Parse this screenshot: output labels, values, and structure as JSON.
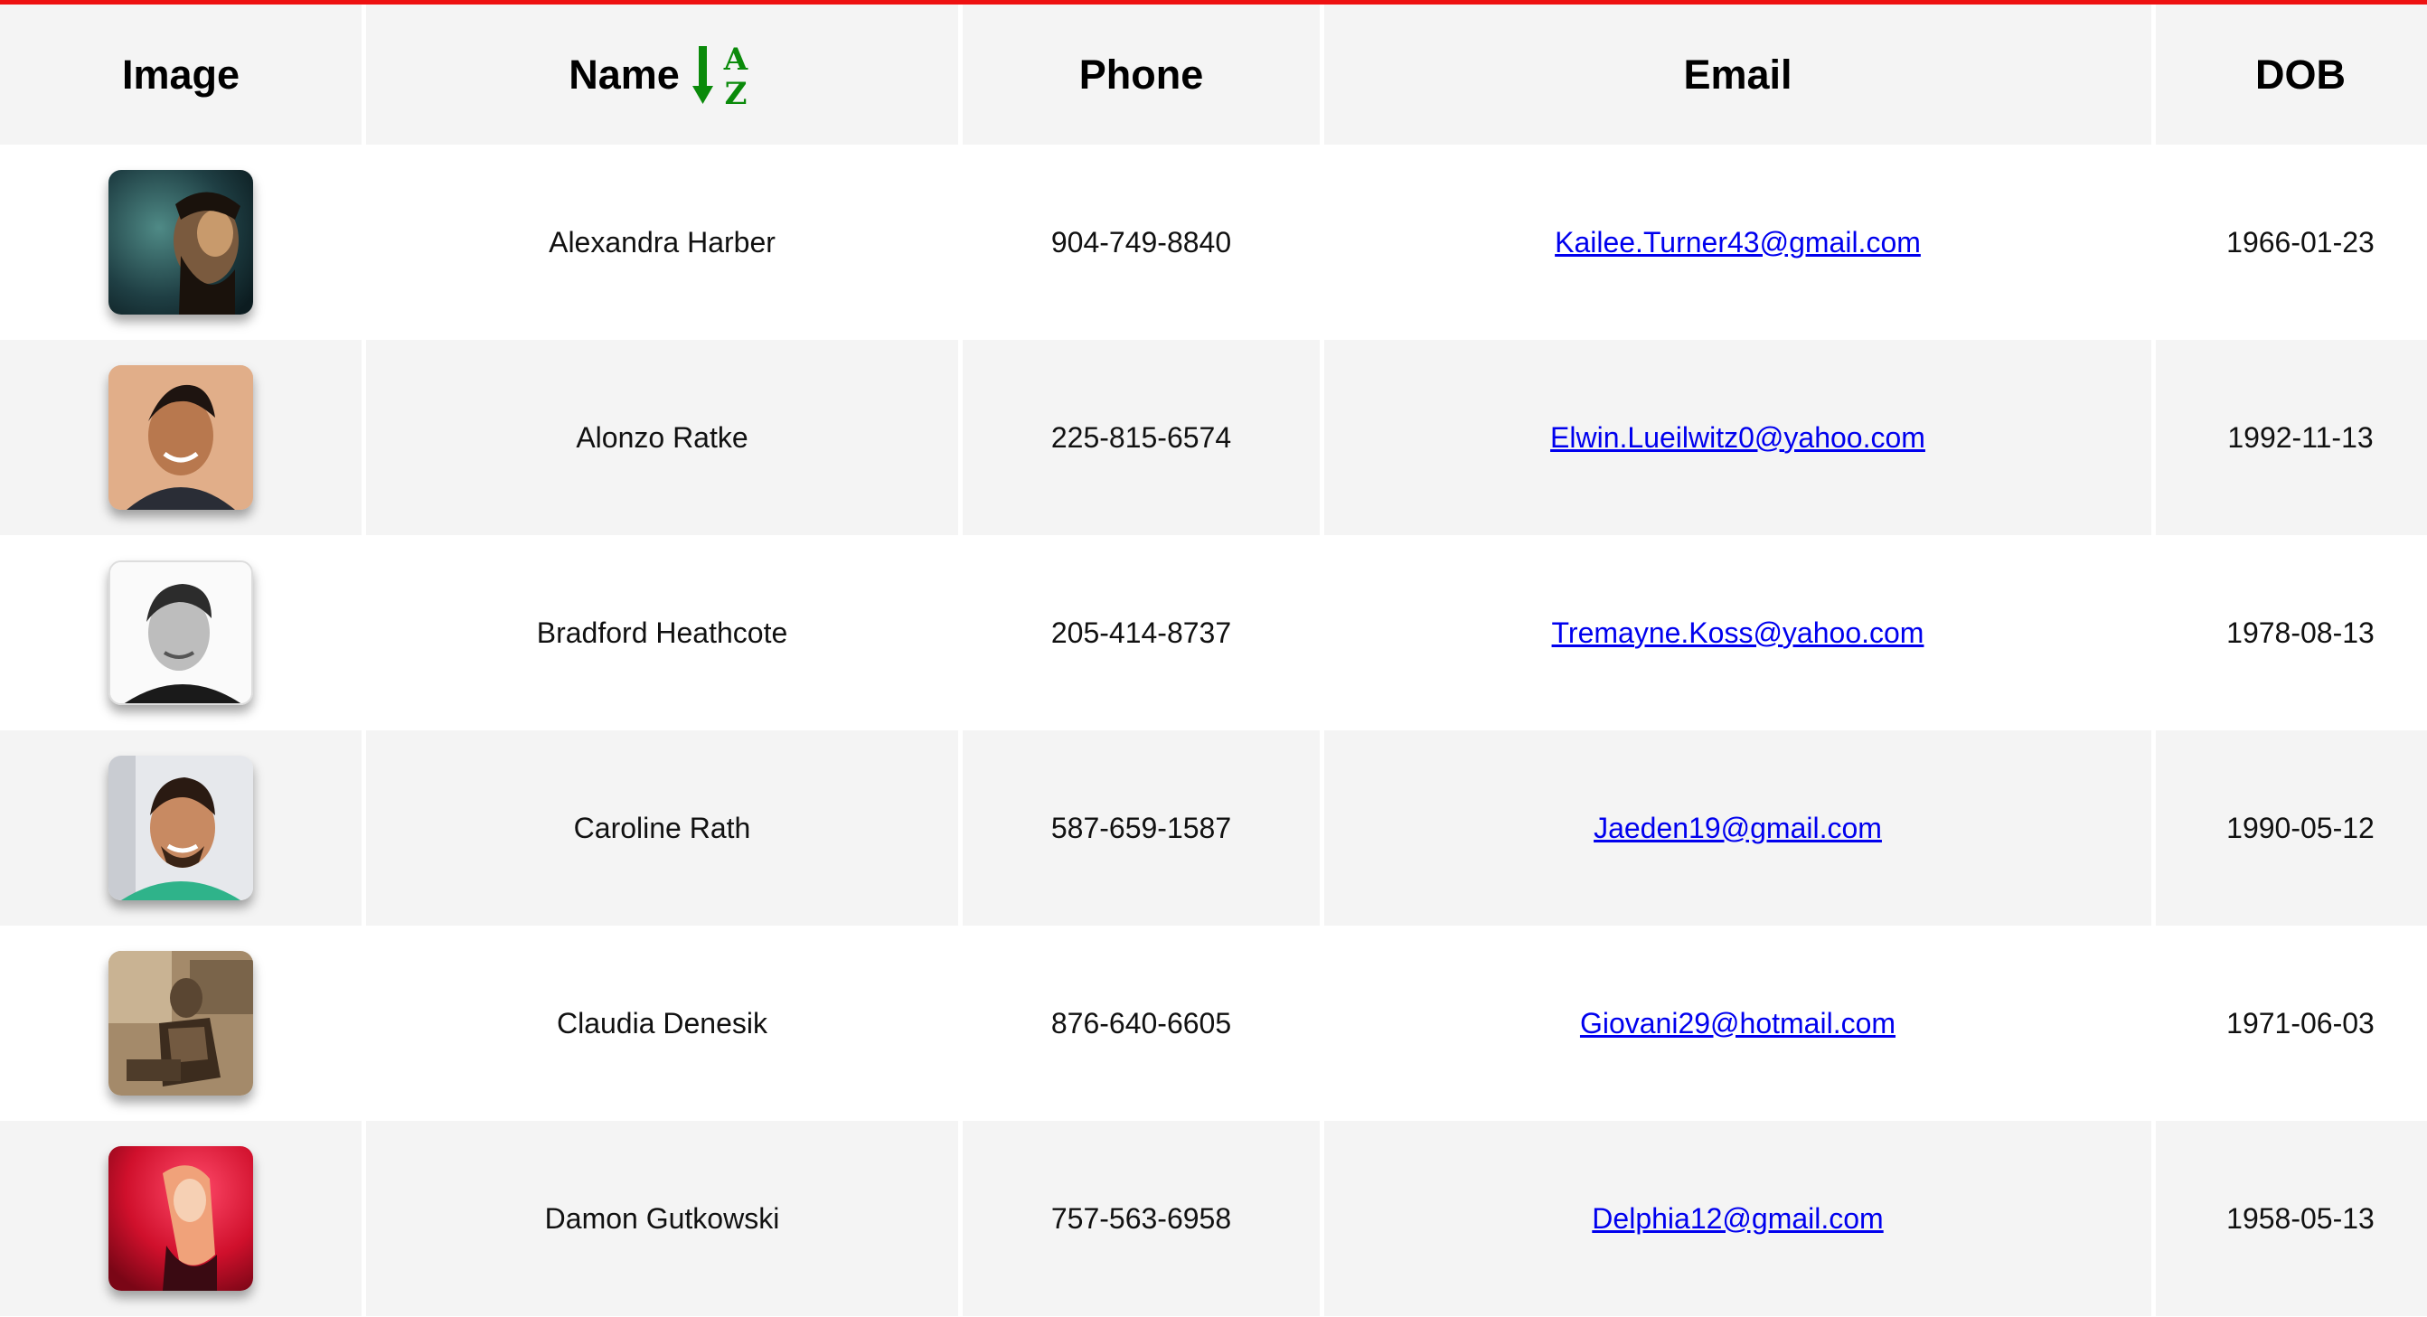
{
  "table": {
    "headers": {
      "image": "Image",
      "name": "Name",
      "phone": "Phone",
      "email": "Email",
      "dob": "DOB"
    },
    "sort": {
      "column": "name",
      "direction": "ascending",
      "icon": "sort-alpha-down-icon",
      "icon_letters": [
        "A",
        "Z"
      ],
      "icon_color": "#0a8a0a"
    },
    "rows": [
      {
        "avatar": "avatar-photo-bearded-man-teal",
        "name": "Alexandra Harber",
        "phone": "904-749-8840",
        "email": "Kailee.Turner43@gmail.com",
        "dob": "1966-01-23"
      },
      {
        "avatar": "avatar-photo-smiling-man-brick",
        "name": "Alonzo Ratke",
        "phone": "225-815-6574",
        "email": "Elwin.Lueilwitz0@yahoo.com",
        "dob": "1992-11-13"
      },
      {
        "avatar": "avatar-photo-man-black-white",
        "name": "Bradford Heathcote",
        "phone": "205-414-8737",
        "email": "Tremayne.Koss@yahoo.com",
        "dob": "1978-08-13"
      },
      {
        "avatar": "avatar-photo-smiling-man-green-shirt",
        "name": "Caroline Rath",
        "phone": "587-659-1587",
        "email": "Jaeden19@gmail.com",
        "dob": "1990-05-12"
      },
      {
        "avatar": "avatar-photo-sepia-person-sitting",
        "name": "Claudia Denesik",
        "phone": "876-640-6605",
        "email": "Giovani29@hotmail.com",
        "dob": "1971-06-03"
      },
      {
        "avatar": "avatar-photo-woman-red-light",
        "name": "Damon Gutkowski",
        "phone": "757-563-6958",
        "email": "Delphia12@gmail.com",
        "dob": "1958-05-13"
      }
    ]
  },
  "colors": {
    "top_accent": "#ee1111",
    "header_bg": "#f4f4f4",
    "row_alt_bg": "#f4f4f4",
    "link": "#0000ee"
  }
}
